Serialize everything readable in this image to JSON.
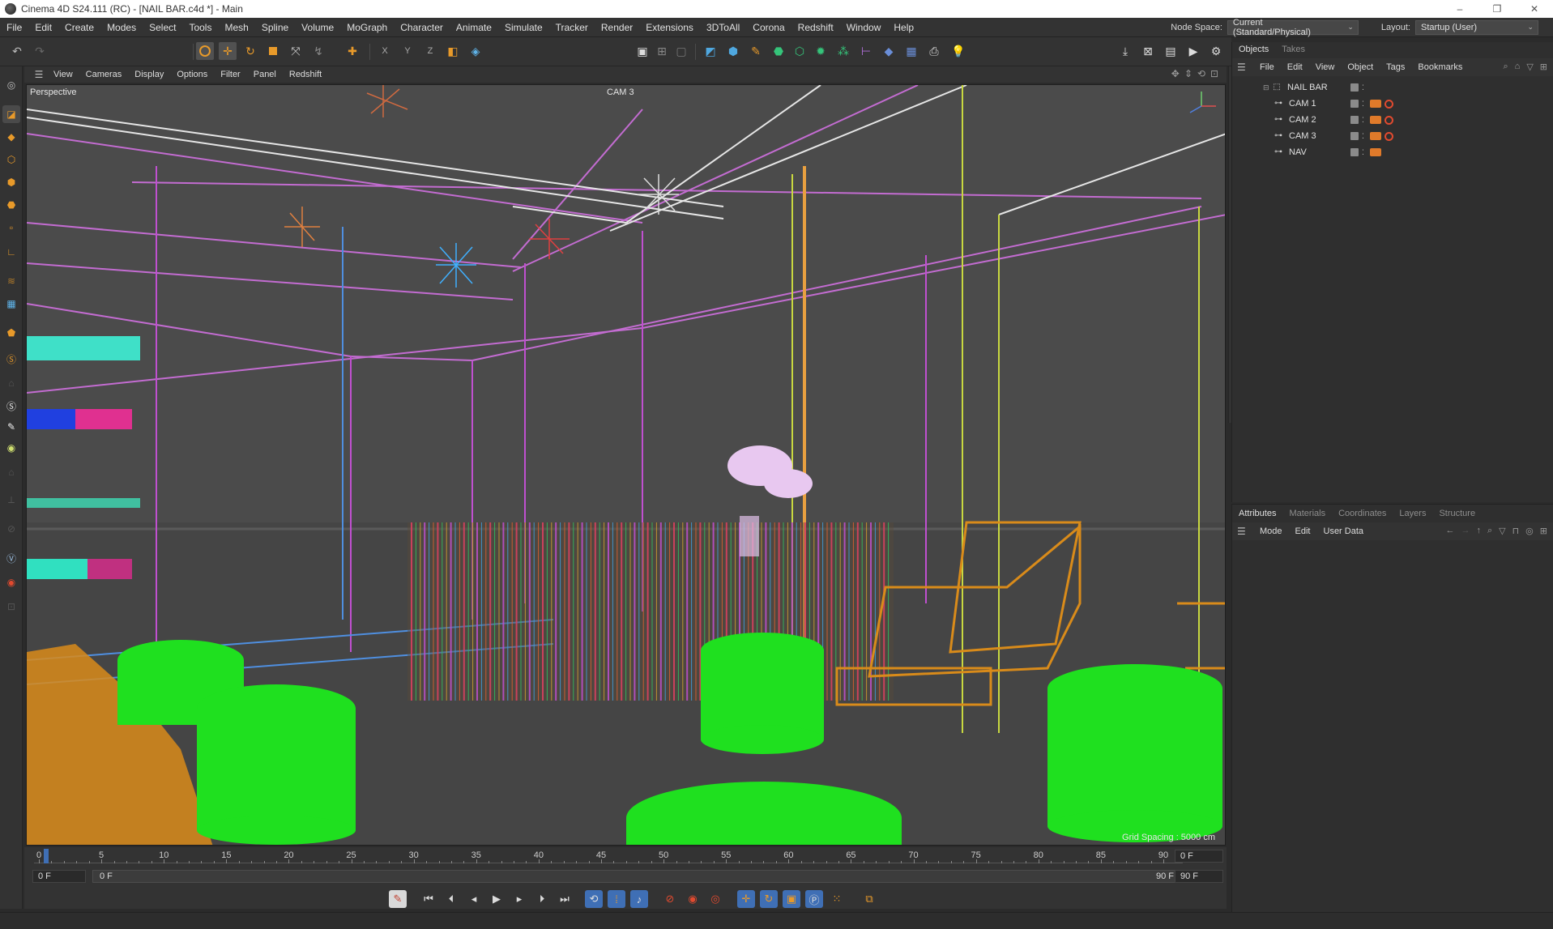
{
  "window": {
    "title": "Cinema 4D S24.111 (RC) - [NAIL BAR.c4d *] - Main",
    "controls": [
      "–",
      "❐",
      "✕"
    ]
  },
  "menubar": {
    "items": [
      "File",
      "Edit",
      "Create",
      "Modes",
      "Select",
      "Tools",
      "Mesh",
      "Spline",
      "Volume",
      "MoGraph",
      "Character",
      "Animate",
      "Simulate",
      "Tracker",
      "Render",
      "Extensions",
      "3DToAll",
      "Corona",
      "Redshift",
      "Window",
      "Help"
    ],
    "node_space_label": "Node Space:",
    "node_space_value": "Current (Standard/Physical)",
    "layout_label": "Layout:",
    "layout_value": "Startup (User)"
  },
  "viewport": {
    "menu": [
      "View",
      "Cameras",
      "Display",
      "Options",
      "Filter",
      "Panel",
      "Redshift"
    ],
    "view_name": "Perspective",
    "camera_name": "CAM 3",
    "grid_spacing": "Grid Spacing : 5000 cm"
  },
  "timeline": {
    "ticks": [
      "0",
      "5",
      "10",
      "15",
      "20",
      "25",
      "30",
      "35",
      "40",
      "45",
      "50",
      "55",
      "60",
      "65",
      "70",
      "75",
      "80",
      "85",
      "90"
    ],
    "current_frame": "0 F",
    "start_frame": "0 F",
    "range_start": "0 F",
    "range_end": "90 F",
    "end_frame_top": "0 F",
    "end_frame": "90 F"
  },
  "objects_panel": {
    "tabs": [
      "Objects",
      "Takes"
    ],
    "menu": [
      "File",
      "Edit",
      "View",
      "Object",
      "Tags",
      "Bookmarks"
    ],
    "objects": [
      {
        "name": "NAIL BAR",
        "type": "null-icon",
        "has_tags": false
      },
      {
        "name": "CAM 1",
        "type": "camera-icon",
        "has_tags": true
      },
      {
        "name": "CAM 2",
        "type": "camera-icon",
        "has_tags": true
      },
      {
        "name": "CAM 3",
        "type": "camera-icon",
        "has_tags": true
      },
      {
        "name": "NAV",
        "type": "camera-icon",
        "has_tags": true
      }
    ]
  },
  "attributes_panel": {
    "tabs": [
      "Attributes",
      "Materials",
      "Coordinates",
      "Layers",
      "Structure"
    ],
    "menu": [
      "Mode",
      "Edit",
      "User Data"
    ]
  },
  "colors": {
    "accent_orange": "#e07a2a",
    "accent_blue": "#3f6fb5",
    "wire_green": "#22e022",
    "wire_orange": "#d98b1a",
    "wire_magenta": "#c040c8"
  }
}
